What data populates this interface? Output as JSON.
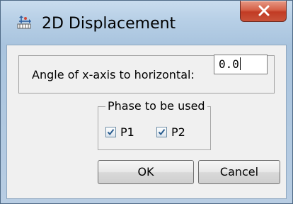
{
  "window": {
    "title": "2D Displacement",
    "accent_color": "#c13b24"
  },
  "title_icon": "move-axes-icon",
  "close_icon": "close-x-icon",
  "angle": {
    "label": "Angle of x-axis to horizontal:",
    "value": "0.0"
  },
  "phase": {
    "legend": "Phase to be used",
    "options": [
      {
        "label": "P1",
        "checked": true
      },
      {
        "label": "P2",
        "checked": true
      }
    ]
  },
  "buttons": {
    "ok": "OK",
    "cancel": "Cancel"
  }
}
